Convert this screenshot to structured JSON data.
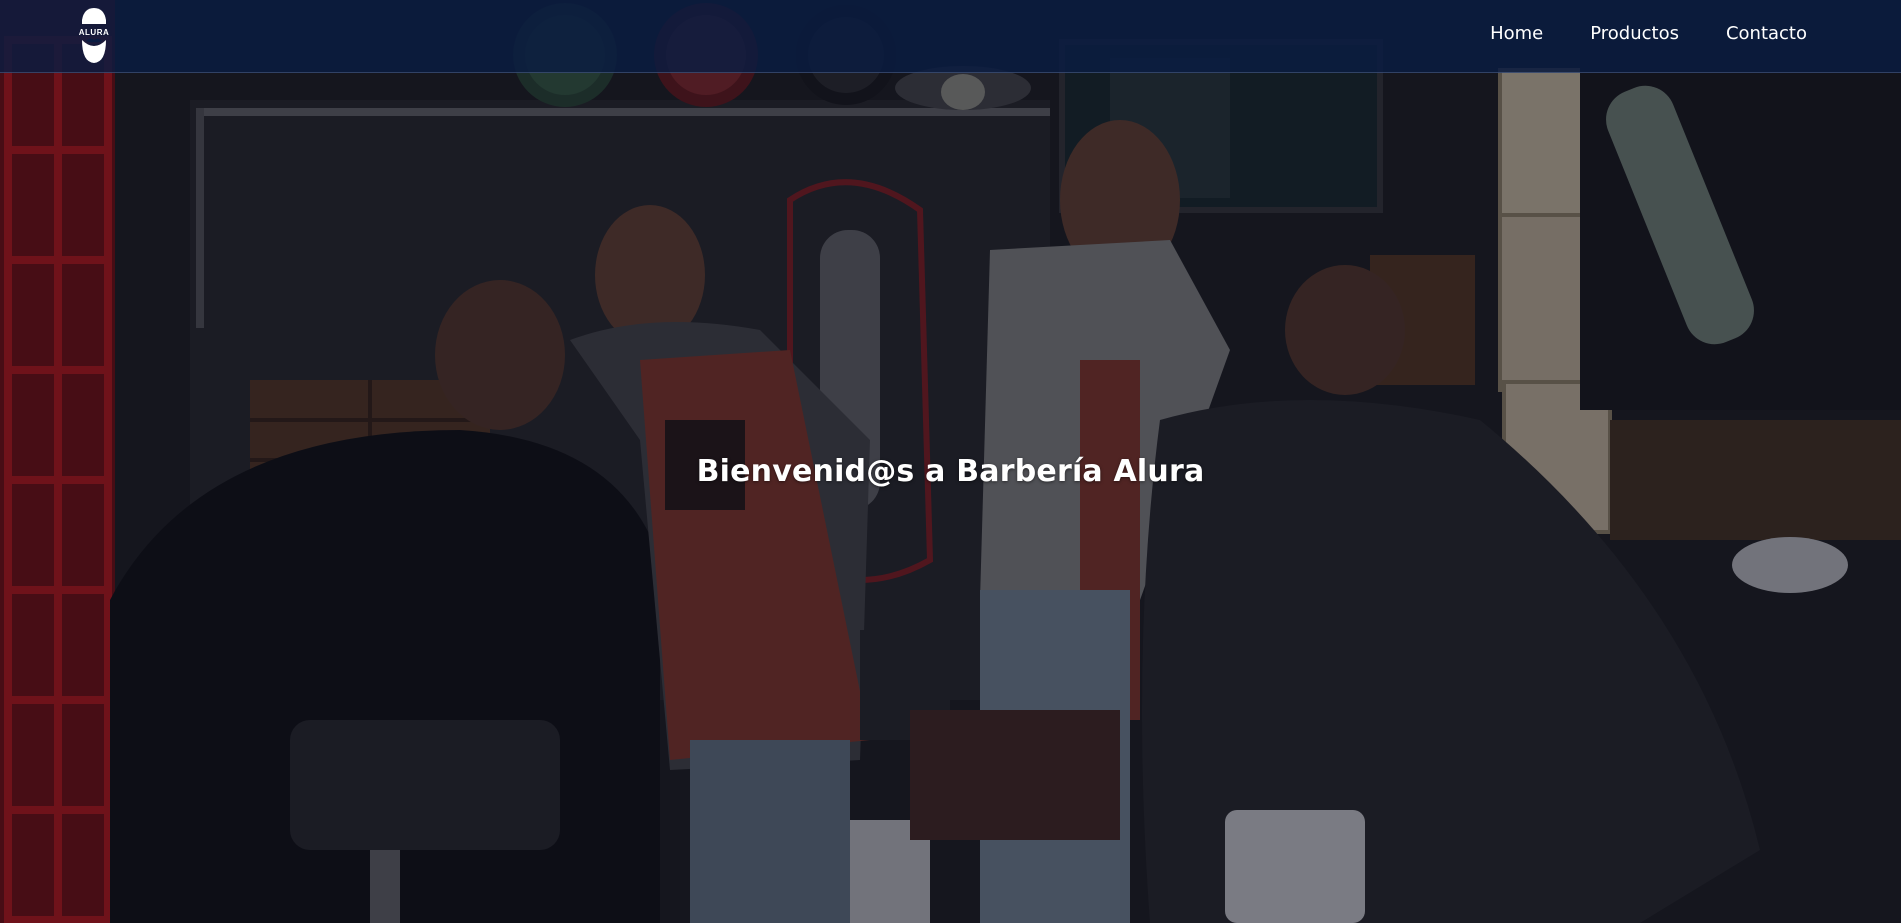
{
  "header": {
    "logo_text": "ALURA",
    "nav": [
      {
        "label": "Home"
      },
      {
        "label": "Productos"
      },
      {
        "label": "Contacto"
      }
    ]
  },
  "hero": {
    "title": "Bienvenid@s a Barbería Alura",
    "overlay_color": "#0a1c42"
  },
  "colors": {
    "header_bg": "#0a1c42",
    "nav_text": "#ffffff",
    "title_text": "#ffffff"
  },
  "icons": {
    "logo": "barber-mustache-logo-icon"
  }
}
